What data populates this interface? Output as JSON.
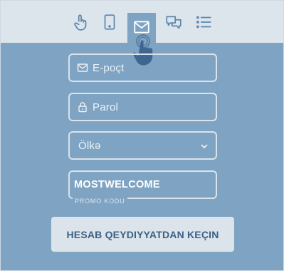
{
  "tabs": [
    {
      "icon": "hand-pointer-icon"
    },
    {
      "icon": "tablet-icon"
    },
    {
      "icon": "envelope-icon",
      "active": true
    },
    {
      "icon": "chat-bubbles-icon"
    },
    {
      "icon": "list-icon"
    }
  ],
  "form": {
    "email_placeholder": "E-poçt",
    "password_placeholder": "Parol",
    "country_placeholder": "Ölkə",
    "promo_value": "MOSTWELCOME",
    "promo_label": "PROMO KODU",
    "submit_label": "HESAB QEYDIYYATDAN KEÇIN"
  },
  "colors": {
    "background": "#7ea3c3",
    "tabbar": "#dde5ec",
    "button_text": "#3a5f86",
    "hand": "#3f6690"
  }
}
